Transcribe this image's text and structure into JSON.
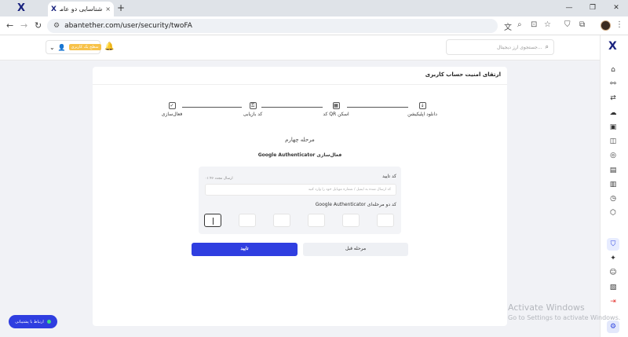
{
  "browser": {
    "tab_title": "شناسایی دو عاملی | آبان تتر",
    "tab_close": "×",
    "new_tab": "+",
    "url": "abantether.com/user/security/twoFA",
    "win_min": "—",
    "win_max": "❐",
    "win_close": "✕"
  },
  "header": {
    "level_badge": "سطح یک کاربری",
    "user_chevron": "⌄",
    "search_placeholder": "جستجوی ارز دیجیتال..."
  },
  "card": {
    "title": "ارتقای امنیت حساب کاربری",
    "steps": [
      {
        "label": "دانلود اپلیکیشن"
      },
      {
        "label": "اسکن QR کد"
      },
      {
        "label": "کد بازیابی"
      },
      {
        "label": "فعال‌سازی"
      }
    ],
    "stage_title": "مرحله چهارم",
    "stage_subtitle": "فعال‌سازی Google Authenticator",
    "confirm_code_label": "کد تایید",
    "resend_text": "ارسال مجدد ۰۱:۴۶",
    "code_placeholder": "کد ارسال شده به ایمیل / شماره موبایل خود را وارد کنید",
    "ga_code_label": "کد دو مرحله‌ای Google Authenticator",
    "confirm_button": "تایید",
    "previous_button": "مرحله قبل"
  },
  "support": {
    "label": "ارتباط با پشتیبانی"
  },
  "watermark": {
    "line1": "Activate Windows",
    "line2": "Go to Settings to activate Windows."
  }
}
